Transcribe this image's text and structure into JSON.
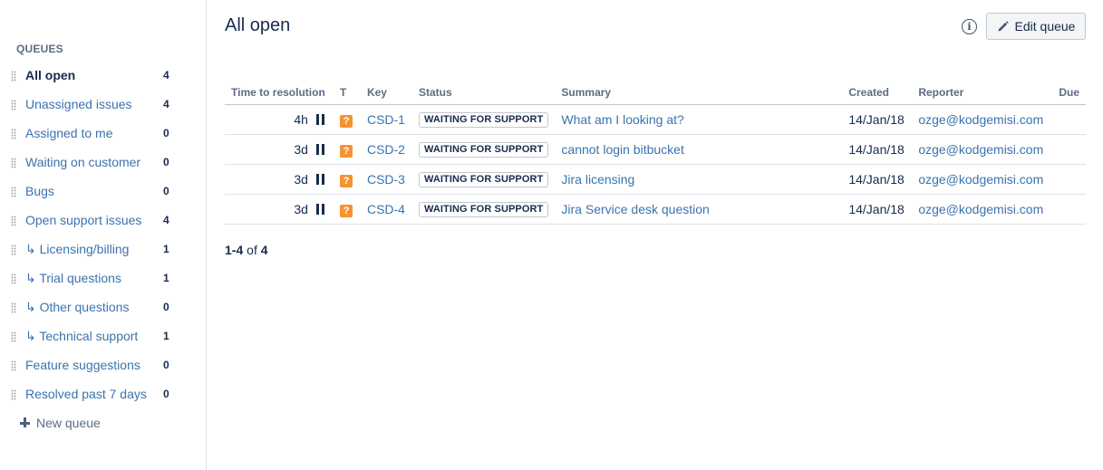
{
  "sidebar": {
    "heading": "QUEUES",
    "queues": [
      {
        "label": "All open",
        "count": "4",
        "active": true
      },
      {
        "label": "Unassigned issues",
        "count": "4"
      },
      {
        "label": "Assigned to me",
        "count": "0"
      },
      {
        "label": "Waiting on customer",
        "count": "0"
      },
      {
        "label": "Bugs",
        "count": "0"
      },
      {
        "label": "Open support issues",
        "count": "4"
      },
      {
        "label": "↳ Licensing/billing",
        "count": "1"
      },
      {
        "label": "↳ Trial questions",
        "count": "1"
      },
      {
        "label": "↳ Other questions",
        "count": "0"
      },
      {
        "label": "↳ Technical support",
        "count": "1"
      },
      {
        "label": "Feature suggestions",
        "count": "0"
      },
      {
        "label": "Resolved past 7 days",
        "count": "0"
      }
    ],
    "new_queue_label": "New queue"
  },
  "main": {
    "title": "All open",
    "info_icon_glyph": "i",
    "edit_button_label": "Edit queue",
    "columns": [
      "Time to resolution",
      "T",
      "Key",
      "Status",
      "Summary",
      "Created",
      "Reporter",
      "Due"
    ],
    "issues": [
      {
        "time": "4h",
        "type_glyph": "?",
        "key": "CSD-1",
        "status": "WAITING FOR SUPPORT",
        "summary": "What am I looking at?",
        "created": "14/Jan/18",
        "reporter": "ozge@kodgemisi.com",
        "due": ""
      },
      {
        "time": "3d",
        "type_glyph": "?",
        "key": "CSD-2",
        "status": "WAITING FOR SUPPORT",
        "summary": "cannot login bitbucket",
        "created": "14/Jan/18",
        "reporter": "ozge@kodgemisi.com",
        "due": ""
      },
      {
        "time": "3d",
        "type_glyph": "?",
        "key": "CSD-3",
        "status": "WAITING FOR SUPPORT",
        "summary": "Jira licensing",
        "created": "14/Jan/18",
        "reporter": "ozge@kodgemisi.com",
        "due": ""
      },
      {
        "time": "3d",
        "type_glyph": "?",
        "key": "CSD-4",
        "status": "WAITING FOR SUPPORT",
        "summary": "Jira Service desk question",
        "created": "14/Jan/18",
        "reporter": "ozge@kodgemisi.com",
        "due": ""
      }
    ],
    "pagination": {
      "start": "1",
      "dash": "-",
      "end": "4",
      "of": " of ",
      "total": "4"
    }
  },
  "colors": {
    "link": "#3b73af",
    "text": "#172b4d",
    "type_question": "#f79232",
    "border": "#dfe1e6"
  },
  "icons": {
    "grip": "drag-grip-icon",
    "plus": "plus-icon",
    "info": "info-icon",
    "edit": "pencil-icon",
    "pause": "pause-icon",
    "type": "question-type-icon"
  }
}
